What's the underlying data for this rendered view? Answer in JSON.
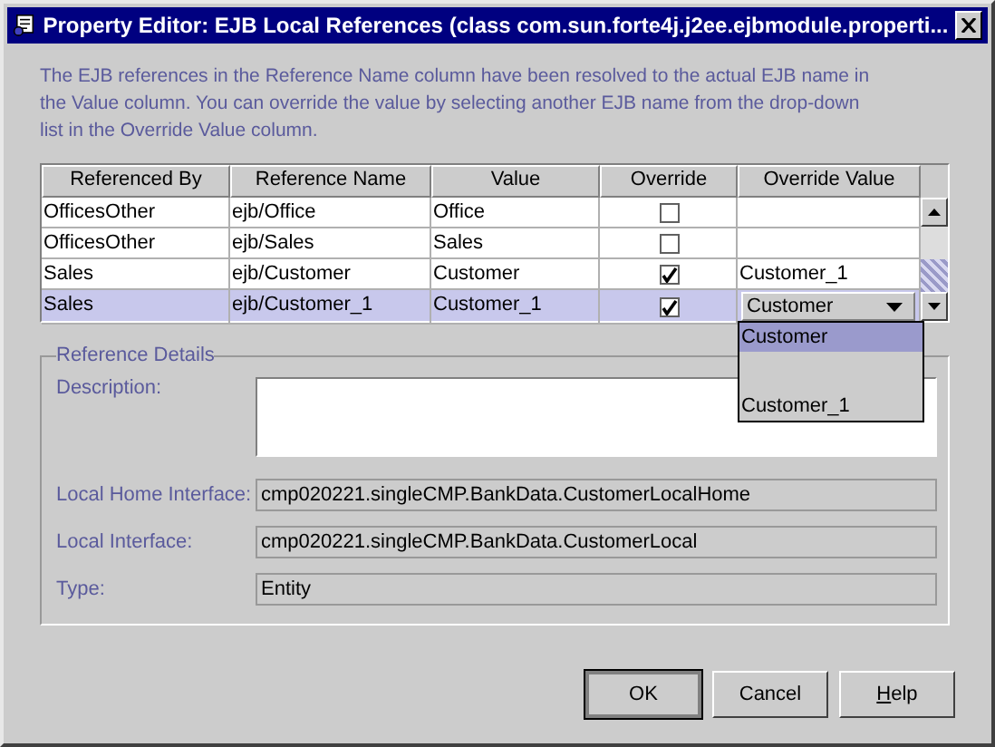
{
  "window": {
    "title": "Property Editor: EJB Local References (class com.sun.forte4j.j2ee.ejbmodule.properti..."
  },
  "instructions": "The EJB references in the Reference Name column have been resolved to the actual EJB name in the Value column.  You can override the value by selecting another EJB name from the drop-down list in the Override Value column.",
  "table": {
    "columns": [
      "Referenced By",
      "Reference Name",
      "Value",
      "Override",
      "Override Value"
    ],
    "rows": [
      {
        "referenced_by": "OfficesOther",
        "reference_name": "ejb/Office",
        "value": "Office",
        "override": false,
        "override_value": {
          "kind": "text"
        },
        "selected": false
      },
      {
        "referenced_by": "OfficesOther",
        "reference_name": "ejb/Sales",
        "value": "Sales",
        "override": false,
        "override_value": {
          "kind": "text"
        },
        "selected": false
      },
      {
        "referenced_by": "Sales",
        "reference_name": "ejb/Customer",
        "value": "Customer",
        "override": true,
        "override_value": {
          "kind": "text",
          "text": "Customer_1"
        },
        "selected": false
      },
      {
        "referenced_by": "Sales",
        "reference_name": "ejb/Customer_1",
        "value": "Customer_1",
        "override": true,
        "override_value": {
          "kind": "combo",
          "text": "Customer"
        },
        "selected": true
      }
    ],
    "dropdown": {
      "options": [
        {
          "label": "Customer",
          "selected": true
        },
        {
          "label": "Customer_1",
          "selected": false
        }
      ]
    }
  },
  "details": {
    "title": "Reference Details",
    "fields": [
      {
        "label": "Description:",
        "kind": "textarea"
      },
      {
        "label": "Local Home Interface:",
        "kind": "readonly",
        "value": "cmp020221.singleCMP.BankData.CustomerLocalHome"
      },
      {
        "label": "Local Interface:",
        "kind": "readonly",
        "value": "cmp020221.singleCMP.BankData.CustomerLocal"
      },
      {
        "label": "Type:",
        "kind": "readonly",
        "value": "Entity"
      }
    ]
  },
  "buttons": [
    {
      "label": "OK",
      "default": true,
      "mnemonic": false
    },
    {
      "label": "Cancel",
      "default": false,
      "mnemonic": false
    },
    {
      "label": "Help",
      "default": false,
      "mnemonic": true
    }
  ]
}
